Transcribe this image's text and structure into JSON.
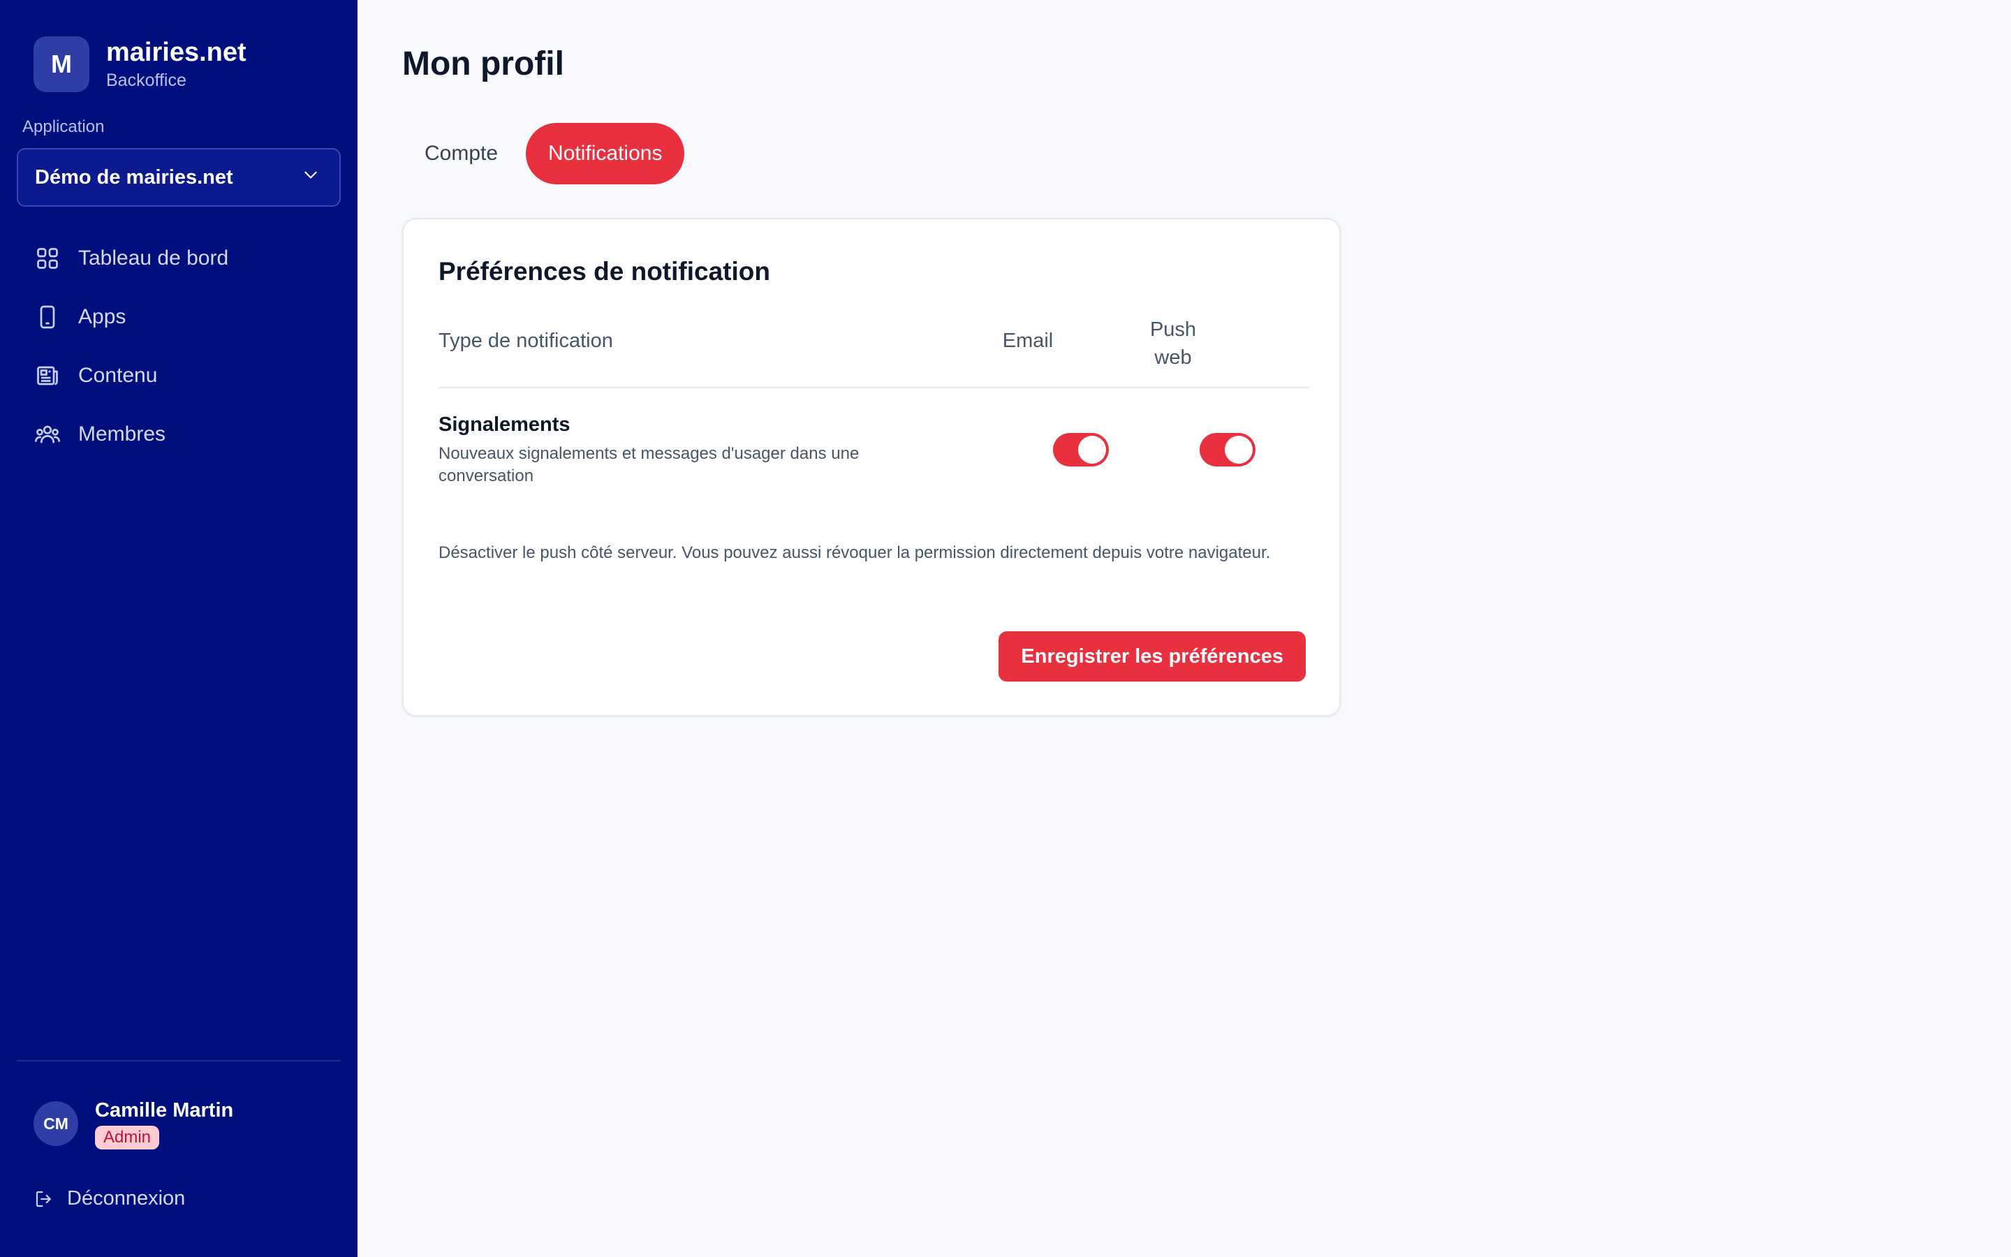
{
  "brand": {
    "logo_letter": "M",
    "name": "mairies.net",
    "subtitle": "Backoffice"
  },
  "application": {
    "label": "Application",
    "selected": "Démo de mairies.net"
  },
  "nav": {
    "items": [
      {
        "label": "Tableau de bord",
        "icon": "grid-icon"
      },
      {
        "label": "Apps",
        "icon": "phone-icon"
      },
      {
        "label": "Contenu",
        "icon": "newspaper-icon"
      },
      {
        "label": "Membres",
        "icon": "users-icon"
      }
    ]
  },
  "user": {
    "initials": "CM",
    "name": "Camille Martin",
    "role": "Admin"
  },
  "logout": {
    "label": "Déconnexion"
  },
  "page": {
    "title": "Mon profil"
  },
  "tabs": [
    {
      "label": "Compte",
      "active": false
    },
    {
      "label": "Notifications",
      "active": true
    }
  ],
  "preferences": {
    "title": "Préférences de notification",
    "columns": {
      "type": "Type de notification",
      "email": "Email",
      "push_line1": "Push",
      "push_line2": "web"
    },
    "rows": [
      {
        "title": "Signalements",
        "description": "Nouveaux signalements et messages d'usager dans une conversation",
        "email_enabled": true,
        "push_enabled": true
      }
    ],
    "note": "Désactiver le push côté serveur. Vous pouvez aussi révoquer la permission directement depuis votre navigateur.",
    "save_label": "Enregistrer les préférences"
  },
  "colors": {
    "sidebar_bg": "#000f7e",
    "accent": "#e8303f",
    "page_bg": "#f8f9fc"
  }
}
